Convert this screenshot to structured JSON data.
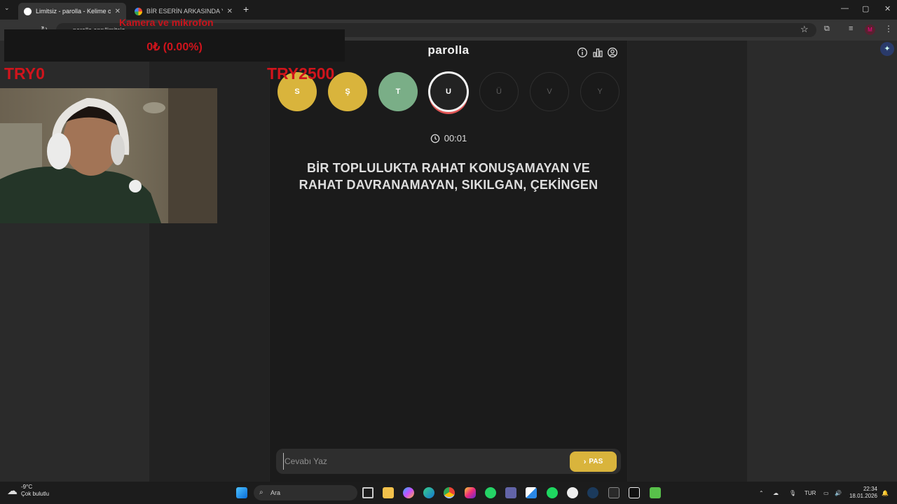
{
  "browser": {
    "tabs": [
      {
        "title": "Limitsiz - parolla - Kelime oyunu",
        "active": true
      },
      {
        "title": "BİR ESERİN ARKASINDA YER AL",
        "active": false
      }
    ],
    "url": "parolla.app/limitsiz"
  },
  "overlay": {
    "title": "Kamera ve mikrofon",
    "amount": "0₺ (0.00%)",
    "try_left": "TRY0",
    "try_right": "TRY2500"
  },
  "game": {
    "brand": "parolla",
    "letters": [
      {
        "char": "S",
        "state": "correct-yellow"
      },
      {
        "char": "Ş",
        "state": "correct-yellow"
      },
      {
        "char": "T",
        "state": "correct-green"
      },
      {
        "char": "U",
        "state": "current"
      },
      {
        "char": "Ü",
        "state": "pending"
      },
      {
        "char": "V",
        "state": "pending"
      },
      {
        "char": "Y",
        "state": "pending"
      }
    ],
    "timer": "00:01",
    "question": "BİR TOPLULUKTA RAHAT KONUŞAMAYAN VE RAHAT DAVRANAMAYAN, SIKILGAN, ÇEKİNGEN",
    "input_placeholder": "Cevabı Yaz",
    "pass_label": "PAS",
    "colors": {
      "yellow": "#d9b43c",
      "green": "#7aae87",
      "current_ring": "#e15656"
    }
  },
  "taskbar": {
    "weather_temp": "-9°C",
    "weather_desc": "Çok bulutlu",
    "search_placeholder": "Ara",
    "language": "TUR",
    "time": "22:34",
    "date": "18.01.2026"
  }
}
